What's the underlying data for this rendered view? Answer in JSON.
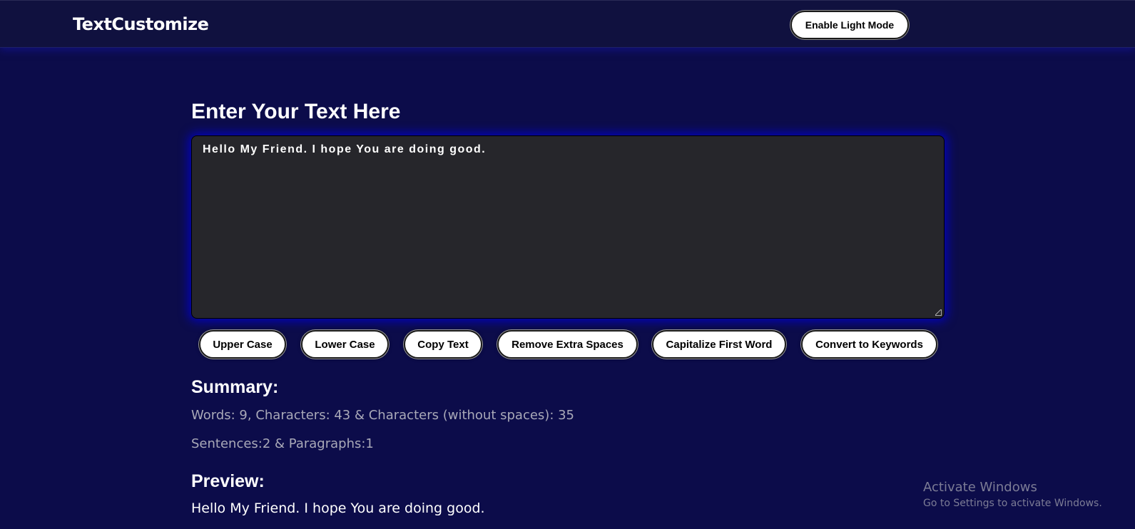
{
  "navbar": {
    "brand": "TextCustomize",
    "mode_button": "Enable Light Mode"
  },
  "editor": {
    "heading": "Enter Your Text Here",
    "value": "Hello My Friend. I hope You are doing good."
  },
  "actions": {
    "upper_case": "Upper Case",
    "lower_case": "Lower Case",
    "copy_text": "Copy Text",
    "remove_extra_spaces": "Remove Extra Spaces",
    "capitalize_first_word": "Capitalize First Word",
    "convert_to_keywords": "Convert to Keywords"
  },
  "summary": {
    "title": "Summary:",
    "line1": "Words: 9, Characters: 43 & Characters (without spaces): 35",
    "line2": "Sentences:2 & Paragraphs:1"
  },
  "preview": {
    "title": "Preview:",
    "text": "Hello My Friend. I hope You are doing good."
  },
  "watermark": {
    "title": "Activate Windows",
    "subtitle": "Go to Settings to activate Windows."
  },
  "colors": {
    "background": "#0c0c4a",
    "navbar": "#10113f",
    "textarea": "#26262b",
    "glow": "#0000dc"
  }
}
